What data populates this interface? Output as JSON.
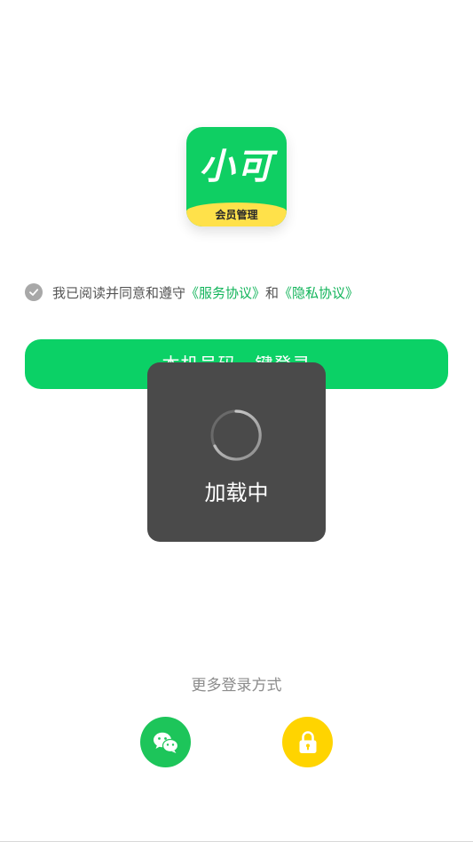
{
  "logo": {
    "title": "小可",
    "band_text": "会员管理"
  },
  "agreement": {
    "prefix": "我已阅读并同意和遵守",
    "service_link": "《服务协议》",
    "conjunction": "和",
    "privacy_link": "《隐私协议》",
    "checkbox_icon": "check-circle-icon"
  },
  "login_button": {
    "label": "本机号码一键登录"
  },
  "loading_toast": {
    "label": "加载中",
    "icon": "spinner-icon"
  },
  "more_login": {
    "label": "更多登录方式",
    "options": [
      {
        "icon": "wechat-icon"
      },
      {
        "icon": "lock-icon"
      }
    ]
  },
  "colors": {
    "brand_green": "#0bd166",
    "link_green": "#12b45a",
    "logo_band_yellow": "#ffe14a",
    "lock_yellow": "#ffd400",
    "wechat_green": "#1dc55a",
    "toast_bg": "#4a4a4a"
  }
}
